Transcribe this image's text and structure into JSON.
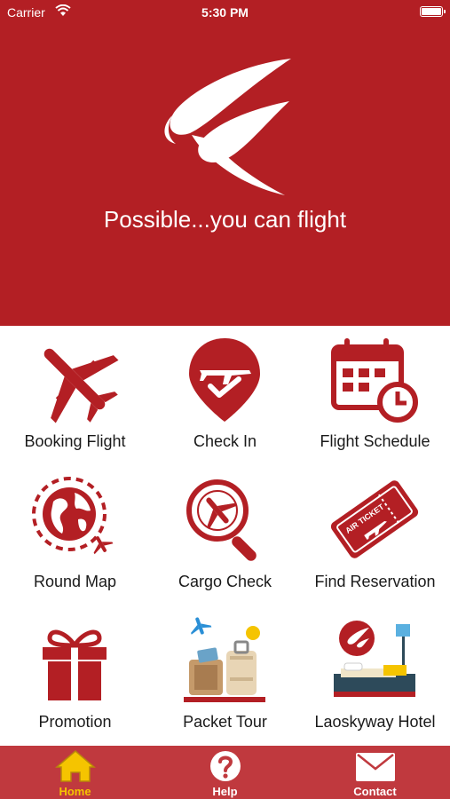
{
  "status_bar": {
    "carrier": "Carrier",
    "time": "5:30 PM"
  },
  "hero": {
    "tagline": "Possible...you can flight"
  },
  "menu": [
    {
      "label": "Booking Flight"
    },
    {
      "label": "Check In"
    },
    {
      "label": "Flight Schedule"
    },
    {
      "label": "Round Map"
    },
    {
      "label": "Cargo Check"
    },
    {
      "label": "Find Reservation"
    },
    {
      "label": "Promotion"
    },
    {
      "label": "Packet Tour"
    },
    {
      "label": "Laoskyway Hotel"
    }
  ],
  "ticket_text": "AIR TICKET",
  "tabbar": {
    "tabs": [
      {
        "label": "Home",
        "active": true
      },
      {
        "label": "Help"
      },
      {
        "label": "Contact"
      }
    ]
  },
  "colors": {
    "brand_red": "#b31f24",
    "tabbar_red": "#c0393e",
    "active_yellow": "#f5c400"
  }
}
